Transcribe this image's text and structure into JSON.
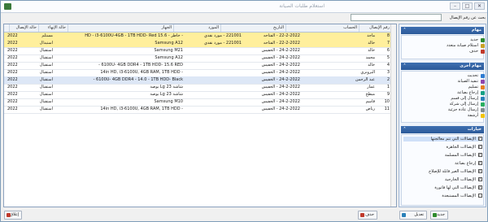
{
  "window": {
    "title": "استعلام طلبات الصيانة"
  },
  "search": {
    "label": "بحث عن رقم الإيصال",
    "value": ""
  },
  "grid": {
    "columns": [
      "رقم الإيصال",
      "الحساب",
      "التاريخ",
      "المورد",
      "الجهاز",
      "حالة الإنهاء",
      "حالة الإيصال",
      ""
    ],
    "rows": [
      [
        "8",
        "ماجد",
        "",
        "22-2-2022 - الفتاحه",
        "221001 - مورد نقدي",
        "- خاطر - 15.6 HD - i3-6100U-4GB - 1TB HDD- Red",
        "مستلم",
        "2022",
        "yellow"
      ],
      [
        "7",
        "خالد",
        "",
        "22-2-2022 - الفتاحه",
        "221001 - مورد نقدي",
        "Samsung A12",
        "استبدال",
        "2022",
        "yellow"
      ],
      [
        "6",
        "خالد",
        "",
        "24-2-2022 - الخفيس",
        "",
        "Samsung M21",
        "استقبال",
        "2022",
        ""
      ],
      [
        "5",
        "محمد",
        "",
        "24-2-2022 - الخفيس",
        "",
        "Samsung A12",
        "استقبال",
        "2022",
        ""
      ],
      [
        "4",
        "خالد",
        "",
        "24-2-2022 - الخفيس",
        "",
        "6100U- 4GB DDR4 - 1TB HDD- 15.6 RED -",
        "استقبال",
        "2022",
        ""
      ],
      [
        "3",
        "البرونزي",
        "",
        "24-2-2022 - الخفيس",
        "",
        "- 14in HD, i3-6100U, 4GB RAM, 1TB HDD",
        "استقبال",
        "2022",
        ""
      ],
      [
        "2",
        "عبد الرحمن",
        "",
        "24-2-2022 - الخفيس",
        "",
        "6100U- 4GB DDR4 - 14.0 - 1TB HDD- Black -",
        "استقبال",
        "2022",
        "sel"
      ],
      [
        "1",
        "عمار",
        "",
        "24-2-2022 - الخفيس",
        "",
        "شاشة Lg 23 بوصة",
        "استقبال",
        "2022",
        ""
      ],
      [
        "9",
        "مبطح",
        "",
        "24-2-2022 - الخفيس",
        "",
        "شاشة Lg 23 بوصة",
        "استقبال",
        "2022",
        ""
      ],
      [
        "10",
        "قاسم",
        "",
        "24-2-2022 - الخفيس",
        "",
        "Samsung M10",
        "استقبال",
        "2022",
        ""
      ],
      [
        "11",
        "رياض",
        "",
        "24-2-2022 - الخفيس",
        "",
        "- 14in HD, i3-6100U, 4GB RAM, 1TB HDD",
        "استقبال",
        "2022",
        ""
      ]
    ]
  },
  "sidebar": {
    "tasks_header": "مهام",
    "tasks": [
      {
        "label": "جديد",
        "icon": "new-icon",
        "color": "#2e8b2e"
      },
      {
        "label": "استلام صيانة متعدد",
        "icon": "receive-icon",
        "color": "#c9a227"
      },
      {
        "label": "حذف",
        "icon": "delete-icon",
        "color": "#c0392b"
      }
    ],
    "other_header": "مهام أخرى",
    "others": [
      {
        "label": "تحديث",
        "icon": "refresh-icon",
        "color": "#2e7bd1"
      },
      {
        "label": "تنفيذ الصيانة",
        "icon": "execute-icon",
        "color": "#8e44ad"
      },
      {
        "label": "تسليم",
        "icon": "deliver-icon",
        "color": "#e67e22"
      },
      {
        "label": "إرجاع بضاعة",
        "icon": "return-icon",
        "color": "#16a085"
      },
      {
        "label": "إرسال إلى قسم",
        "icon": "send-dept-icon",
        "color": "#2980b9"
      },
      {
        "label": "إرسال إلى شركة",
        "icon": "send-company-icon",
        "color": "#27ae60"
      },
      {
        "label": "إرسال عادة جزئية",
        "icon": "partial-icon",
        "color": "#7f8c8d"
      },
      {
        "label": "أرشفة",
        "icon": "archive-icon",
        "color": "#f1c40f"
      }
    ],
    "options_header": "خيارات",
    "options": [
      {
        "label": "الإيصالات التي تتم معالجتها",
        "checked": true,
        "hl": true
      },
      {
        "label": "الإيصالات الجاهزة",
        "checked": true,
        "hl": false
      },
      {
        "label": "الإيصالات المسلمة",
        "checked": true,
        "hl": false
      },
      {
        "label": "إرجاع بضاعة",
        "checked": true,
        "hl": false
      },
      {
        "label": "الإيصالات الغير قابلة للإصلاح",
        "checked": true,
        "hl": false
      },
      {
        "label": "الإيصالات الخارجية",
        "checked": true,
        "hl": false
      },
      {
        "label": "الإيصالات التي لها فاتورة",
        "checked": true,
        "hl": false
      },
      {
        "label": "الإيصالات المستبعدة",
        "checked": false,
        "hl": false
      }
    ]
  },
  "toolbar": {
    "new_label": "جديد",
    "edit_label": "تعديل",
    "delete_label": "حذف",
    "close_label": "إغلاق"
  }
}
